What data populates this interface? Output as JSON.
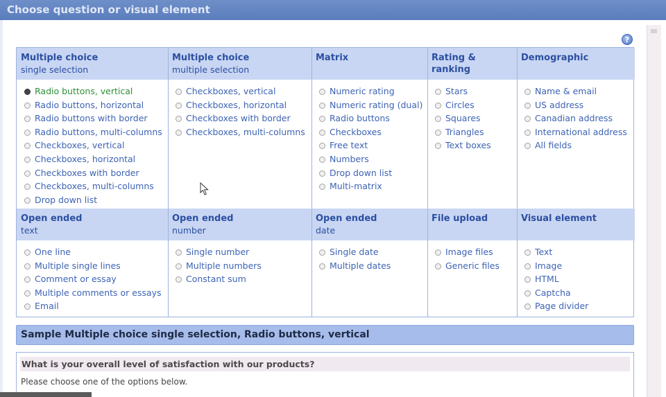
{
  "window": {
    "title": "Choose question or visual element"
  },
  "help": {
    "glyph": "?"
  },
  "sections": [
    {
      "title": "Multiple choice",
      "subtitle": "single selection",
      "items": [
        {
          "label": "Radio buttons, vertical",
          "selected": true
        },
        {
          "label": "Radio buttons, horizontal"
        },
        {
          "label": "Radio buttons with border"
        },
        {
          "label": "Radio buttons, multi-columns"
        },
        {
          "label": "Checkboxes, vertical"
        },
        {
          "label": "Checkboxes, horizontal"
        },
        {
          "label": "Checkboxes with border"
        },
        {
          "label": "Checkboxes, multi-columns"
        },
        {
          "label": "Drop down list"
        }
      ]
    },
    {
      "title": "Multiple choice",
      "subtitle": "multiple selection",
      "items": [
        {
          "label": "Checkboxes, vertical"
        },
        {
          "label": "Checkboxes, horizontal"
        },
        {
          "label": "Checkboxes with border"
        },
        {
          "label": "Checkboxes, multi-columns"
        }
      ]
    },
    {
      "title": "Matrix",
      "subtitle": "",
      "items": [
        {
          "label": "Numeric rating"
        },
        {
          "label": "Numeric rating (dual)"
        },
        {
          "label": "Radio buttons"
        },
        {
          "label": "Checkboxes"
        },
        {
          "label": "Free text"
        },
        {
          "label": "Numbers"
        },
        {
          "label": "Drop down list"
        },
        {
          "label": "Multi-matrix"
        }
      ]
    },
    {
      "title": "Rating & ranking",
      "subtitle": "",
      "items": [
        {
          "label": "Stars"
        },
        {
          "label": "Circles"
        },
        {
          "label": "Squares"
        },
        {
          "label": "Triangles"
        },
        {
          "label": "Text boxes"
        }
      ]
    },
    {
      "title": "Demographic",
      "subtitle": "",
      "items": [
        {
          "label": "Name & email"
        },
        {
          "label": "US address"
        },
        {
          "label": "Canadian address"
        },
        {
          "label": "International address"
        },
        {
          "label": "All fields"
        }
      ]
    },
    {
      "title": "Open ended",
      "subtitle": "text",
      "items": [
        {
          "label": "One line"
        },
        {
          "label": "Multiple single lines"
        },
        {
          "label": "Comment or essay"
        },
        {
          "label": "Multiple comments or essays"
        },
        {
          "label": "Email"
        }
      ]
    },
    {
      "title": "Open ended",
      "subtitle": "number",
      "items": [
        {
          "label": "Single number"
        },
        {
          "label": "Multiple numbers"
        },
        {
          "label": "Constant sum"
        }
      ]
    },
    {
      "title": "Open ended",
      "subtitle": "date",
      "items": [
        {
          "label": "Single date"
        },
        {
          "label": "Multiple dates"
        }
      ]
    },
    {
      "title": "File upload",
      "subtitle": "",
      "items": [
        {
          "label": "Image files"
        },
        {
          "label": "Generic files"
        }
      ]
    },
    {
      "title": "Visual element",
      "subtitle": "",
      "items": [
        {
          "label": "Text"
        },
        {
          "label": "Image"
        },
        {
          "label": "HTML"
        },
        {
          "label": "Captcha"
        },
        {
          "label": "Page divider"
        }
      ]
    }
  ],
  "sample": {
    "heading": "Sample Multiple choice single selection, Radio buttons, vertical",
    "question": "What is your overall level of satisfaction with our products?",
    "instruction": "Please choose one of the options below."
  },
  "colors": {
    "titlebar": "#6080c0",
    "header_fill": "#c8d6f3",
    "link": "#3d63b5",
    "selected": "#2f8f36",
    "sample_bar": "#a6bcea"
  }
}
